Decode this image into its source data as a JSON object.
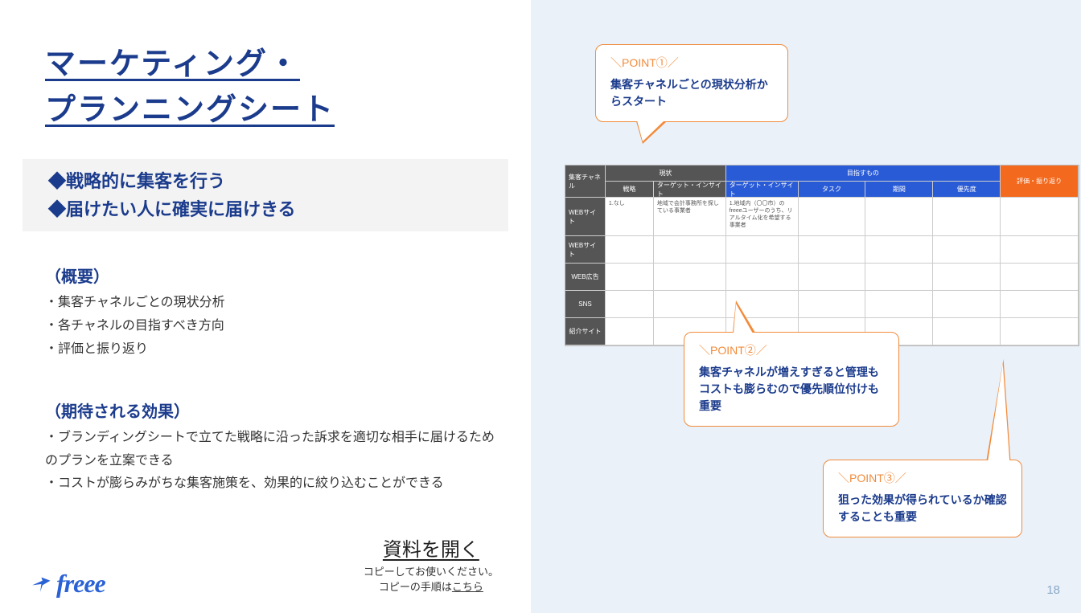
{
  "title_line1": "マーケティング・",
  "title_line2": "プランニングシート",
  "strategy": {
    "line1": "◆戦略的に集客を行う",
    "line2": "◆届けたい人に確実に届けきる"
  },
  "overview": {
    "heading": "（概要）",
    "items": [
      "・集客チャネルごとの現状分析",
      "・各チャネルの目指すべき方向",
      "・評価と振り返り"
    ]
  },
  "effects": {
    "heading": "（期待される効果）",
    "items": [
      "・ブランディングシートで立てた戦略に沿った訴求を適切な相手に届けるためのプランを立案できる",
      "・コストが膨らみがちな集客施策を、効果的に絞り込むことができる"
    ]
  },
  "cta": {
    "open": "資料を開く",
    "note1": "コピーしてお使いください。",
    "note2_pre": "コピーの手順は",
    "note2_link": "こちら"
  },
  "logo_text": "freee",
  "page_number": "18",
  "callouts": {
    "p1": {
      "label": "＼POINT①／",
      "body": "集客チャネルごとの現状分析からスタート"
    },
    "p2": {
      "label": "＼POINT②／",
      "body": "集客チャネルが増えすぎると管理もコストも膨らむので優先順位付けも重要"
    },
    "p3": {
      "label": "＼POINT③／",
      "body": "狙った効果が得られているか確認することも重要"
    }
  },
  "sheet": {
    "top_headers": {
      "channel": "集客チャネル",
      "current": "現状",
      "target": "目指すもの",
      "eval": "評価・振り返り"
    },
    "sub_headers": {
      "strategy": "戦略",
      "target_insight": "ターゲット・インサイト",
      "target_insight2": "ターゲット・インサイト",
      "task": "タスク",
      "period": "期間",
      "priority": "優先度"
    },
    "rows": [
      "WEBサイト",
      "WEBサイト",
      "WEB広告",
      "SNS",
      "紹介サイト"
    ],
    "row1": {
      "strategy": "1.なし",
      "target_insight": "地域で会計事務所を探している事業者",
      "target_insight2": "1.地域内（〇〇市）のfreeeユーザーのうち、リアルタイム化を希望する事業者"
    }
  }
}
